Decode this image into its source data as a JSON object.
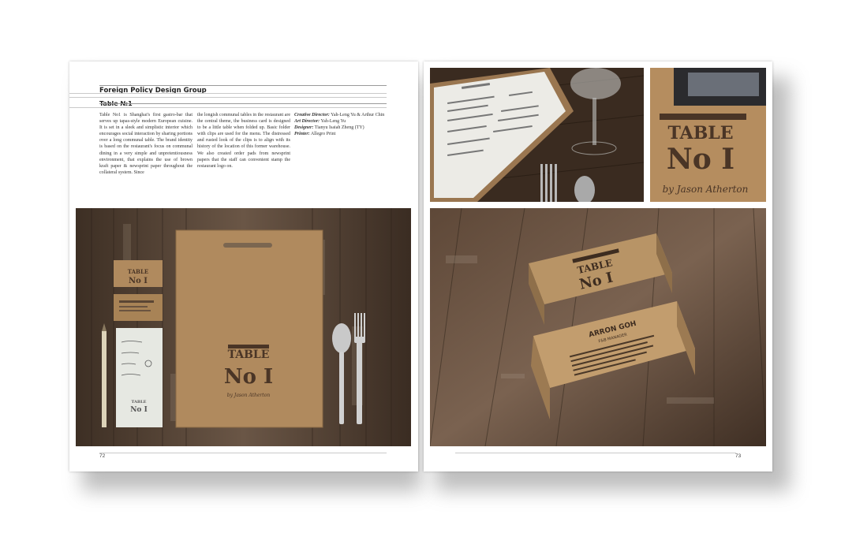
{
  "left_page": {
    "company": "Foreign Policy Design Group",
    "project": "Table №1",
    "paragraph_col1": "Table No1 is Shanghai's first gastro-bar that serves up tapas-style modern European cuisine. It is set in a sleek and simplistic interior which encourages social interaction by sharing portions over a long communal table. The brand identity is based on the restaurant's focus on communal dining in a very simple and unpretentiousness environment, that explains the use of brown kraft paper & newsprint paper throughout the collateral system. Since",
    "paragraph_col2": "the longish communal tables in the restaurant are the central theme, the business card is designed to be a little table when folded up. Basic folder with clips are used for the menu. The distressed and rusted look of the clips is to align with its history of the location of this former warehouse. We also created order pads from newsprint papers that the staff can convenient stamp the restaurant logo on.",
    "credits": [
      {
        "label": "Creative Director:",
        "value": "Yah-Leng Yu & Arthur Chin"
      },
      {
        "label": "Art Director:",
        "value": "Yah-Leng Yu"
      },
      {
        "label": "Designer:",
        "value": "Tianyu Isaiah Zheng (TY)"
      },
      {
        "label": "Printer:",
        "value": "Allegro Print"
      }
    ],
    "page_number": "72"
  },
  "right_page": {
    "page_number": "73"
  },
  "photo_logo": {
    "word": "TABLE",
    "number": "No I",
    "signature": "by Jason Atherton"
  },
  "business_card": {
    "name": "ARRON GOH",
    "title": "F&B MANAGER"
  },
  "colors": {
    "wood_dark": "#4a3a2e",
    "wood_light": "#7a6655",
    "kraft": "#b08a5e",
    "ink": "#3b2d22"
  }
}
